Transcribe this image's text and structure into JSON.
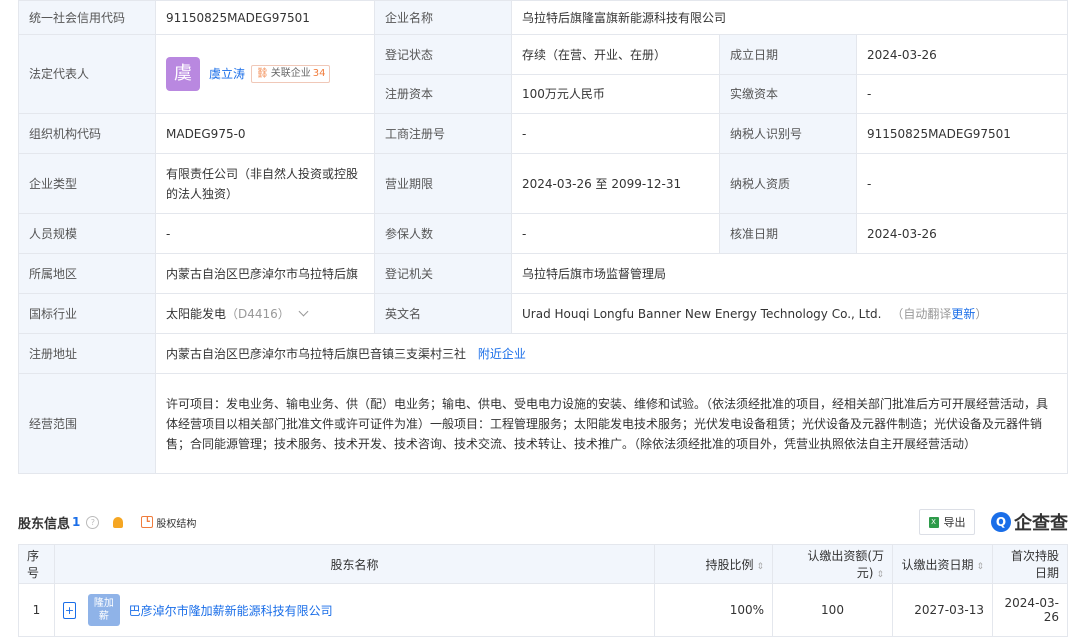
{
  "info": {
    "credit_code_label": "统一社会信用代码",
    "credit_code": "91150825MADEG97501",
    "company_name_label": "企业名称",
    "company_name": "乌拉特后旗隆富旗新能源科技有限公司",
    "legal_rep_label": "法定代表人",
    "legal_rep_avatar": "虞",
    "legal_rep_name": "虞立涛",
    "related_label": "关联企业",
    "related_count": "34",
    "reg_status_label": "登记状态",
    "reg_status": "存续（在营、开业、在册）",
    "founded_label": "成立日期",
    "founded": "2024-03-26",
    "reg_capital_label": "注册资本",
    "reg_capital": "100万元人民币",
    "paid_capital_label": "实缴资本",
    "paid_capital": "-",
    "org_code_label": "组织机构代码",
    "org_code": "MADEG975-0",
    "biz_reg_no_label": "工商注册号",
    "biz_reg_no": "-",
    "taxpayer_id_label": "纳税人识别号",
    "taxpayer_id": "91150825MADEG97501",
    "type_label": "企业类型",
    "type": "有限责任公司（非自然人投资或控股的法人独资）",
    "term_label": "营业期限",
    "term": "2024-03-26 至 2099-12-31",
    "taxpayer_qual_label": "纳税人资质",
    "taxpayer_qual": "-",
    "staff_label": "人员规模",
    "staff": "-",
    "insured_label": "参保人数",
    "insured": "-",
    "approval_date_label": "核准日期",
    "approval_date": "2024-03-26",
    "region_label": "所属地区",
    "region": "内蒙古自治区巴彦淖尔市乌拉特后旗",
    "reg_authority_label": "登记机关",
    "reg_authority": "乌拉特后旗市场监督管理局",
    "industry_label": "国标行业",
    "industry": "太阳能发电",
    "industry_code": "（D4416）",
    "english_name_label": "英文名",
    "english_name": "Urad Houqi Longfu Banner New Energy Technology Co., Ltd.",
    "auto_translate": "（自动翻译",
    "update_label": "更新",
    "auto_translate_close": "）",
    "address_label": "注册地址",
    "address": "内蒙古自治区巴彦淖尔市乌拉特后旗巴音镇三支渠村三社",
    "nearby_label": "附近企业",
    "scope_label": "经营范围",
    "scope": "许可项目：发电业务、输电业务、供（配）电业务；输电、供电、受电电力设施的安装、维修和试验。（依法须经批准的项目，经相关部门批准后方可开展经营活动，具体经营项目以相关部门批准文件或许可证件为准）一般项目：工程管理服务；太阳能发电技术服务；光伏发电设备租赁；光伏设备及元器件制造；光伏设备及元器件销售；合同能源管理；技术服务、技术开发、技术咨询、技术交流、技术转让、技术推广。（除依法须经批准的项目外，凭营业执照依法自主开展经营活动）"
  },
  "shareholders": {
    "title": "股东信息",
    "count": "1",
    "equity_label": "股权结构",
    "export_label": "导出",
    "brand": "企查查",
    "columns": [
      "序号",
      "股东名称",
      "持股比例",
      "认缴出资额(万元)",
      "认缴出资日期",
      "首次持股日期"
    ],
    "rows": [
      {
        "no": "1",
        "avatar": "隆加薪",
        "avatar_l1": "隆加",
        "avatar_l2": "薪",
        "name": "巴彦淖尔市隆加薪新能源科技有限公司",
        "ratio": "100%",
        "amount": "100",
        "sub_date": "2027-03-13",
        "first_date": "2024-03-26"
      }
    ]
  },
  "colors": {
    "label_bg": "#f2f6fc",
    "link": "#1a6ee8",
    "border": "#e4e7ed"
  },
  "icons": [
    "question-icon",
    "bell-icon",
    "equity-icon",
    "excel-icon",
    "brand-logo-icon",
    "plus-icon",
    "chevron-down-icon"
  ]
}
